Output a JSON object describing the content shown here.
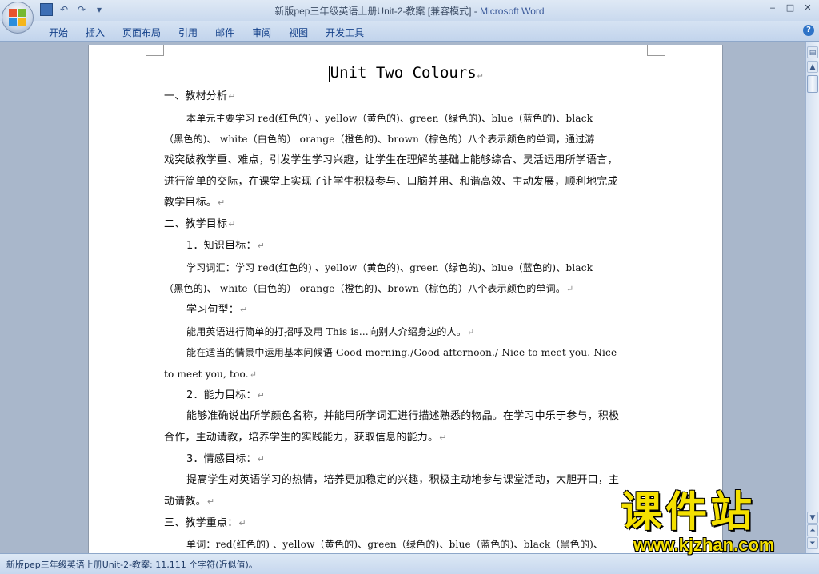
{
  "window": {
    "doc_title": "新版pep三年级英语上册Unit-2-教案 [兼容模式] - ",
    "app_name": "Microsoft Word",
    "qat_undo": "↶",
    "qat_redo": "↷",
    "qat_menu": "▾",
    "minimize": "‒",
    "maximize": "□",
    "close": "✕"
  },
  "ribbon": {
    "tabs": [
      "开始",
      "插入",
      "页面布局",
      "引用",
      "邮件",
      "审阅",
      "视图",
      "开发工具"
    ],
    "help": "?"
  },
  "document": {
    "title": "Unit Two  Colours",
    "lines": [
      "一、教材分析",
      "本单元主要学习 red(红色的) 、yellow（黄色的)、green（绿色的)、blue（蓝色的)、black",
      "（黑色的)、 white（白色的） orange（橙色的)、brown（棕色的）八个表示颜色的单词，通过游",
      "戏突破教学重、难点，引发学生学习兴趣，让学生在理解的基础上能够综合、灵活运用所学语言，",
      "进行简单的交际，在课堂上实现了让学生积极参与、口脑并用、和谐高效、主动发展，顺利地完成",
      "教学目标。",
      "二、教学目标",
      "1．知识目标：",
      "学习词汇：学习 red(红色的) 、yellow（黄色的)、green（绿色的)、blue（蓝色的)、black",
      "（黑色的)、 white（白色的） orange（橙色的)、brown（棕色的）八个表示颜色的单词。",
      "学习句型：",
      "能用英语进行简单的打招呼及用 This is…向别人介绍身边的人。",
      "能在适当的情景中运用基本问候语 Good morning./Good afternoon./ Nice to meet you. Nice",
      "to meet you, too.",
      "2．能力目标：",
      "能够准确说出所学颜色名称，并能用所学词汇进行描述熟悉的物品。在学习中乐于参与，积极",
      "合作，主动请教，培养学生的实践能力，获取信息的能力。",
      "3．情感目标：",
      "提高学生对英语学习的热情，培养更加稳定的兴趣，积极主动地参与课堂活动，大胆开口，主",
      "动请教。",
      "三、教学重点：",
      "单词：red(红色的) 、yellow（黄色的)、green（绿色的)、blue（蓝色的)、black（黑色的)、"
    ],
    "mark": "↵"
  },
  "statusbar": {
    "text": "新版pep三年级英语上册Unit-2-教案: 11,111 个字符(近似值)。"
  },
  "watermark": {
    "name": "课件站",
    "url": "www.kjzhan.com"
  }
}
